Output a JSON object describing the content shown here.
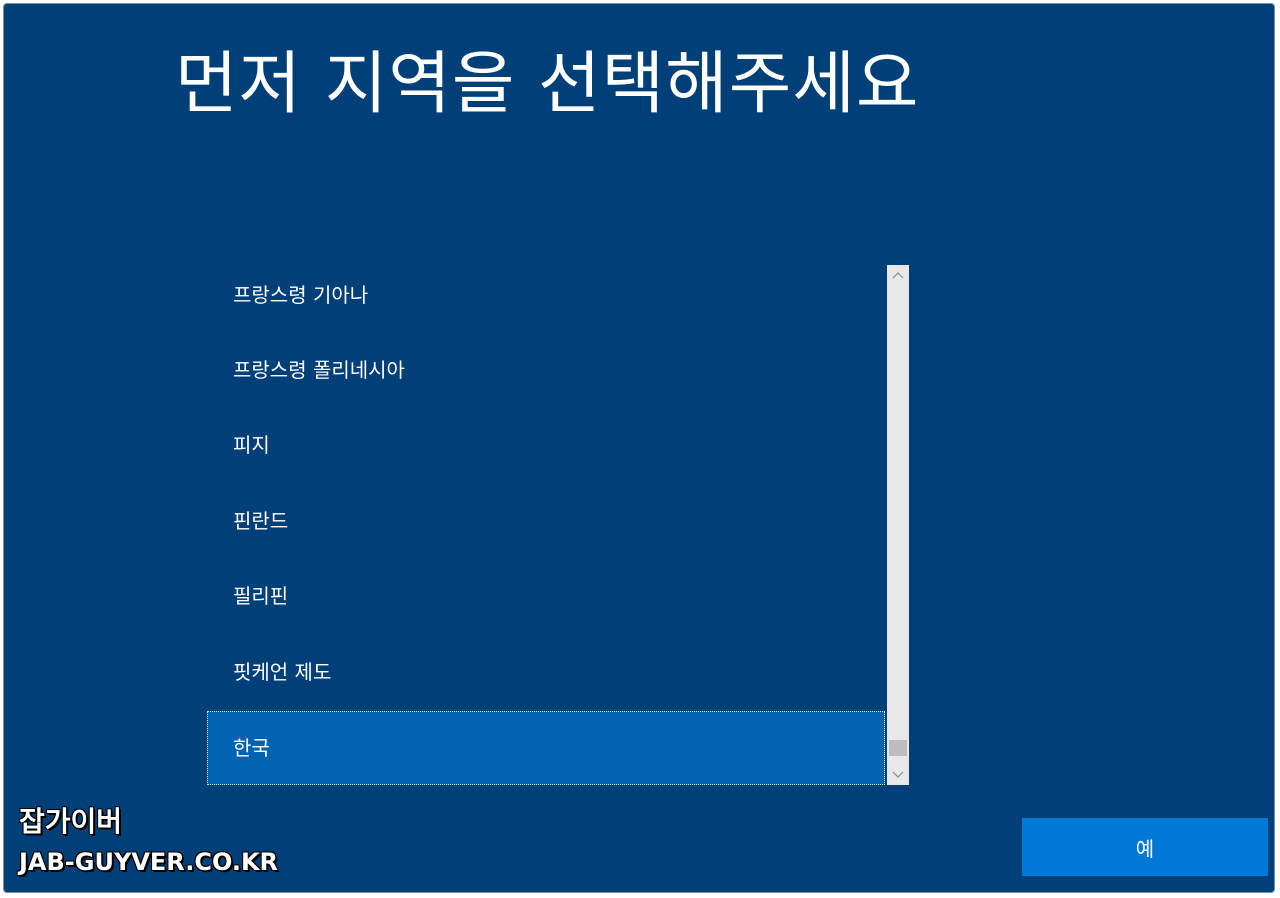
{
  "page": {
    "title": "먼저 지역을 선택해주세요"
  },
  "region_list": {
    "items": [
      {
        "label": "프랑스령 기아나",
        "selected": false
      },
      {
        "label": "프랑스령 폴리네시아",
        "selected": false
      },
      {
        "label": "피지",
        "selected": false
      },
      {
        "label": "핀란드",
        "selected": false
      },
      {
        "label": "필리핀",
        "selected": false
      },
      {
        "label": "핏케언 제도",
        "selected": false
      },
      {
        "label": "한국",
        "selected": true
      }
    ]
  },
  "buttons": {
    "confirm_label": "예"
  },
  "watermark": {
    "line1": "잡가이버",
    "line2": "JAB-GUYVER.CO.KR"
  },
  "colors": {
    "background": "#003f78",
    "selected_item": "#0063b1",
    "button": "#0078d7",
    "scrollbar_track": "#e8e8e8"
  }
}
